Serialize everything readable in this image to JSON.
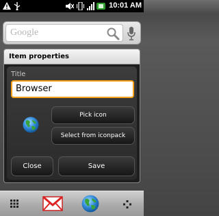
{
  "status_bar": {
    "time": "10:01 AM",
    "icons": [
      "warning-icon",
      "usb-icon",
      "mute-icon",
      "vibrate-icon",
      "signal-icon",
      "battery-icon"
    ]
  },
  "search": {
    "logo_text": "Google",
    "icons": [
      "search-icon",
      "microphone-icon"
    ]
  },
  "dialog": {
    "title": "Item properties",
    "field_label": "Title",
    "title_value": "Browser",
    "pick_icon_label": "Pick icon",
    "iconpack_label": "Select from iconpack",
    "close_label": "Close",
    "save_label": "Save",
    "item_icon": "globe-icon"
  },
  "dock": {
    "items": [
      "app-drawer-icon",
      "gmail-icon",
      "browser-globe-icon",
      "more-icon"
    ]
  }
}
